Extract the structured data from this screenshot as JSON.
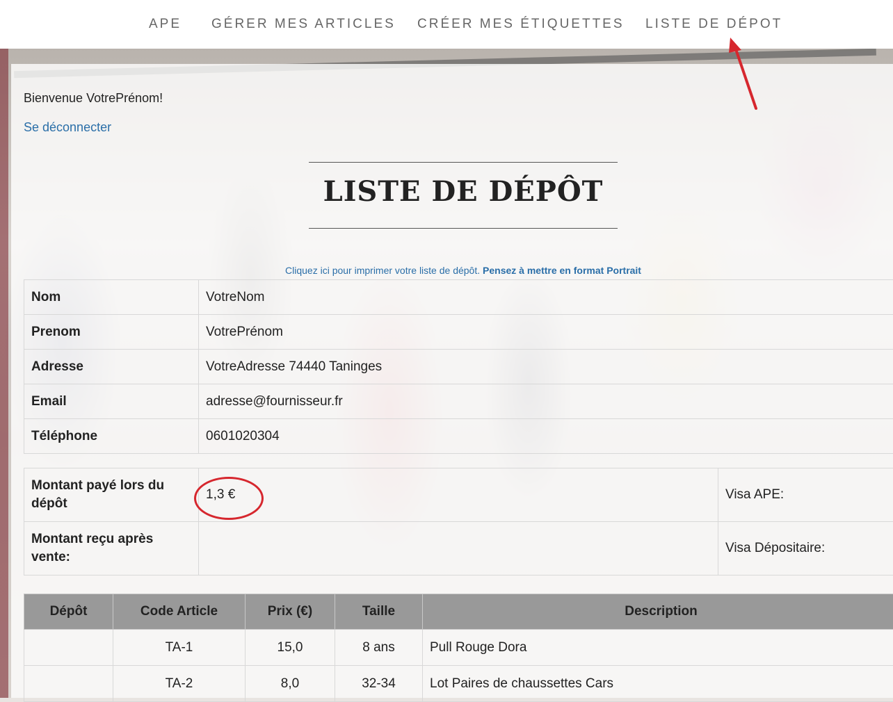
{
  "nav": {
    "items": [
      "APE",
      "GÉRER MES ARTICLES",
      "CRÉER MES ÉTIQUETTES",
      "LISTE DE DÉPOT"
    ]
  },
  "welcome_text": "Bienvenue VotrePrénom!",
  "logout_label": "Se déconnecter",
  "page_title": "LISTE DE DÉPÔT",
  "print": {
    "link_text": "Cliquez ici pour imprimer votre liste de dépôt.",
    "hint_text": "Pensez à mettre en format Portrait"
  },
  "info": [
    {
      "label": "Nom",
      "value": "VotreNom"
    },
    {
      "label": "Prenom",
      "value": "VotrePrénom"
    },
    {
      "label": "Adresse",
      "value": "VotreAdresse 74440 Taninges"
    },
    {
      "label": "Email",
      "value": "adresse@fournisseur.fr"
    },
    {
      "label": "Téléphone",
      "value": "0601020304"
    }
  ],
  "money": {
    "paid_label": "Montant payé lors du dépôt",
    "paid_value": "1,3 €",
    "visa_ape": "Visa APE:",
    "received_label": "Montant reçu après vente:",
    "received_value": "",
    "visa_depositaire": "Visa Dépositaire:"
  },
  "items_table": {
    "headers": [
      "Dépôt",
      "Code Article",
      "Prix (€)",
      "Taille",
      "Description"
    ],
    "rows": [
      {
        "depot": "",
        "code": "TA-1",
        "prix": "15,0",
        "taille": "8 ans",
        "description": "Pull Rouge Dora"
      },
      {
        "depot": "",
        "code": "TA-2",
        "prix": "8,0",
        "taille": "32-34",
        "description": "Lot Paires de chaussettes Cars"
      }
    ]
  },
  "colors": {
    "accent_link": "#2a6ea8",
    "annotation_red": "#d6272e",
    "table_header_bg": "#999999"
  }
}
